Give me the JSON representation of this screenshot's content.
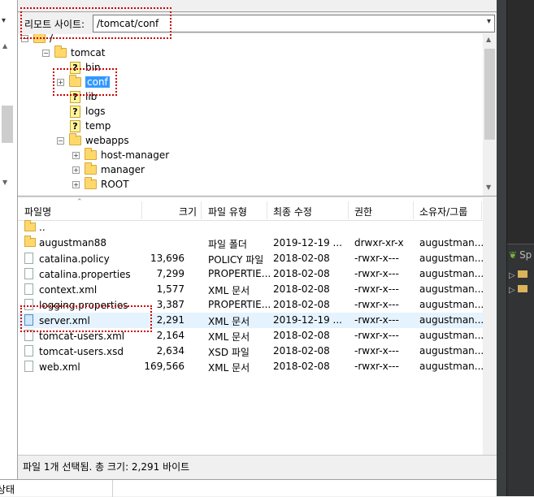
{
  "remote": {
    "label": "리모트 사이트:",
    "path": "/tomcat/conf"
  },
  "tree": {
    "root_label": "/",
    "items": [
      {
        "label": "tomcat",
        "type": "folder"
      },
      {
        "label": "bin",
        "type": "unknown"
      },
      {
        "label": "conf",
        "type": "folder",
        "selected": true
      },
      {
        "label": "lib",
        "type": "unknown"
      },
      {
        "label": "logs",
        "type": "unknown"
      },
      {
        "label": "temp",
        "type": "unknown"
      },
      {
        "label": "webapps",
        "type": "folder"
      },
      {
        "label": "host-manager",
        "type": "folder"
      },
      {
        "label": "manager",
        "type": "folder"
      },
      {
        "label": "ROOT",
        "type": "folder"
      }
    ]
  },
  "filelist": {
    "columns": [
      "파일명",
      "크기",
      "파일 유형",
      "최종 수정",
      "권한",
      "소유자/그룹"
    ],
    "rows": [
      {
        "name": "..",
        "size": "",
        "type": "",
        "modified": "",
        "perm": "",
        "owner": "",
        "icon": "folder"
      },
      {
        "name": "augustman88",
        "size": "",
        "type": "파일 폴더",
        "modified": "2019-12-19 ...",
        "perm": "drwxr-xr-x",
        "owner": "augustman...",
        "icon": "folder"
      },
      {
        "name": "catalina.policy",
        "size": "13,696",
        "type": "POLICY 파일",
        "modified": "2018-02-08",
        "perm": "-rwxr-x---",
        "owner": "augustman...",
        "icon": "file"
      },
      {
        "name": "catalina.properties",
        "size": "7,299",
        "type": "PROPERTIE...",
        "modified": "2018-02-08",
        "perm": "-rwxr-x---",
        "owner": "augustman...",
        "icon": "file"
      },
      {
        "name": "context.xml",
        "size": "1,577",
        "type": "XML 문서",
        "modified": "2018-02-08",
        "perm": "-rwxr-x---",
        "owner": "augustman...",
        "icon": "file"
      },
      {
        "name": "logging.properties",
        "size": "3,387",
        "type": "PROPERTIE...",
        "modified": "2018-02-08",
        "perm": "-rwxr-x---",
        "owner": "augustman...",
        "icon": "file"
      },
      {
        "name": "server.xml",
        "size": "2,291",
        "type": "XML 문서",
        "modified": "2019-12-19 ...",
        "perm": "-rwxr-x---",
        "owner": "augustman...",
        "icon": "file",
        "selected": true
      },
      {
        "name": "tomcat-users.xml",
        "size": "2,164",
        "type": "XML 문서",
        "modified": "2018-02-08",
        "perm": "-rwxr-x---",
        "owner": "augustman...",
        "icon": "file"
      },
      {
        "name": "tomcat-users.xsd",
        "size": "2,634",
        "type": "XSD 파일",
        "modified": "2018-02-08",
        "perm": "-rwxr-x---",
        "owner": "augustman...",
        "icon": "file"
      },
      {
        "name": "web.xml",
        "size": "169,566",
        "type": "XML 문서",
        "modified": "2018-02-08",
        "perm": "-rwxr-x---",
        "owner": "augustman...",
        "icon": "file"
      }
    ]
  },
  "status": {
    "text": "파일 1개 선택됨. 총 크기: 2,291 바이트",
    "bottom_label": "상태"
  },
  "side_panel": {
    "tab_label": "Sp"
  },
  "colors": {
    "selection": "#3399ff",
    "row_selected": "#e5f3ff",
    "annotation": "#d00000"
  }
}
